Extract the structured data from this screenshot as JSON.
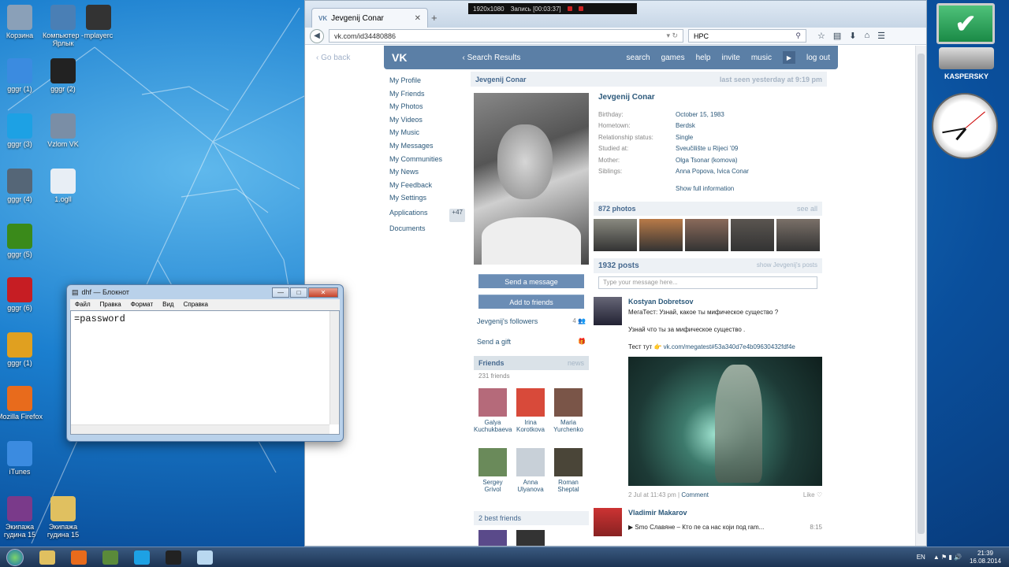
{
  "recorder": {
    "resolution": "1920x1080",
    "status": "Запись [00:03:37]"
  },
  "desktop_icons": [
    {
      "label": "Корзина",
      "icon": "recycle-bin-icon",
      "color": "#8aa0b8"
    },
    {
      "label": "Компьютер - Ярлык",
      "icon": "computer-icon",
      "color": "#4a7fb5"
    },
    {
      "label": "mplayerc",
      "icon": "mplayer-icon",
      "color": "#333333"
    },
    {
      "label": "gggr (1)",
      "icon": "gggr-icon",
      "color": "#3b8be0"
    },
    {
      "label": "gggr (2)",
      "icon": "mpc-be-icon",
      "color": "#222222"
    },
    {
      "label": "gggr (3)",
      "icon": "skype-icon",
      "color": "#1da1e4"
    },
    {
      "label": "Vzlom VK",
      "icon": "settings-icon",
      "color": "#7a8ea6"
    },
    {
      "label": "gggr (4)",
      "icon": "k-lite-icon",
      "color": "#556677"
    },
    {
      "label": "1.ogll",
      "icon": "file-icon",
      "color": "#e8eef5"
    },
    {
      "label": "gggr (5)",
      "icon": "nvidia-icon",
      "color": "#3a8a1a"
    },
    {
      "label": "gggr (6)",
      "icon": "mcafee-icon",
      "color": "#c61d23"
    },
    {
      "label": "gggr (1)",
      "icon": "chrome-icon",
      "color": "#e0a020"
    },
    {
      "label": "Mozilla Firefox",
      "icon": "firefox-icon",
      "color": "#e86b1c"
    },
    {
      "label": "iTunes",
      "icon": "itunes-icon",
      "color": "#3b8be0"
    },
    {
      "label": "Экипажа гудина 15",
      "icon": "archive-icon",
      "color": "#7a3a8a"
    },
    {
      "label": "Экипажа гудина 15",
      "icon": "folder-icon",
      "color": "#e0c060"
    }
  ],
  "browser": {
    "tab_title": "Jevgenij Conar",
    "url": "vk.com/id34480886",
    "search_value": "HPC"
  },
  "vk": {
    "go_back": "Go back",
    "logo": "VK",
    "search_results": "Search Results",
    "menu": [
      "search",
      "games",
      "help",
      "invite",
      "music",
      "log out"
    ],
    "left_menu": [
      "My Profile",
      "My Friends",
      "My Photos",
      "My Videos",
      "My Music",
      "My Messages",
      "My Communities",
      "My News",
      "My Feedback",
      "My Settings"
    ],
    "applications": "Applications",
    "applications_badge": "+47",
    "documents": "Documents",
    "profile_name_header": "Jevgenij Conar",
    "last_seen": "last seen yesterday at 9:19 pm",
    "profile_name": "Jevgenij Conar",
    "info": [
      {
        "label": "Birthday:",
        "value": "October 15, 1983"
      },
      {
        "label": "Hometown:",
        "value": "Berdsk"
      },
      {
        "label": "Relationship status:",
        "value": "Single"
      },
      {
        "label": "Studied at:",
        "value": "Sveučilište u Rijeci '09"
      },
      {
        "label": "Mother:",
        "value": "Olga Tsonar (komova)"
      },
      {
        "label": "Siblings:",
        "value": "Anna Popova, Ivica Conar"
      }
    ],
    "show_full": "Show full information",
    "send_message": "Send a message",
    "add_friend": "Add to friends",
    "followers": "Jevgenij's followers",
    "followers_count": "4",
    "send_gift": "Send a gift",
    "friends_title": "Friends",
    "friends_news": "news",
    "friends_count": "231 friends",
    "friends": [
      {
        "first": "Galya",
        "last": "Kuchukbaeva",
        "color": "#b56a7a"
      },
      {
        "first": "Irina",
        "last": "Korotkova",
        "color": "#d84a3a"
      },
      {
        "first": "Maria",
        "last": "Yurchenko",
        "color": "#7a5548"
      },
      {
        "first": "Sergey",
        "last": "Grivol",
        "color": "#6a8a5a"
      },
      {
        "first": "Anna",
        "last": "Ulyanova",
        "color": "#c8d0d8"
      },
      {
        "first": "Roman",
        "last": "Sheptal",
        "color": "#4a4538"
      }
    ],
    "best_friends": "2 best friends",
    "photos_title": "872 photos",
    "see_all": "see all",
    "photo_colors": [
      "#8a8a80",
      "#b87a48",
      "#8a6a5a",
      "#5a5550",
      "#7a7068"
    ],
    "posts_title": "1932 posts",
    "show_posts": "show Jevgenij's posts",
    "message_placeholder": "Type your message here...",
    "post": {
      "author": "Kostyan Dobretsov",
      "line1": "МегаТест: Узнай, какое ты мифическое существо ?",
      "line2": "Узнай что ты за мифическое существо .",
      "line3_prefix": "Тест тут",
      "link": "vk.com/megatest#53a340d7e4b09630432fdf4e",
      "date": "2 Jul at 11:43 pm",
      "comment": "Comment",
      "like": "Like"
    },
    "post2": {
      "author": "Vladimir Makarov",
      "audio": "Smo Славяне – Кто пе са нас који под ram...",
      "duration": "8:15"
    }
  },
  "notepad": {
    "title": "dhf — Блокнот",
    "menu": [
      "Файл",
      "Правка",
      "Формат",
      "Вид",
      "Справка"
    ],
    "content": "=password"
  },
  "gadgets": {
    "kaspersky": "KASPERSKY"
  },
  "tray": {
    "lang": "EN",
    "time": "21:39",
    "date": "16.08.2014"
  },
  "taskbar_apps": [
    {
      "icon": "explorer-icon",
      "color": "#e0c060"
    },
    {
      "icon": "firefox-icon",
      "color": "#e86b1c"
    },
    {
      "icon": "minecraft-icon",
      "color": "#5a8a3a"
    },
    {
      "icon": "skype-icon",
      "color": "#1da1e4"
    },
    {
      "icon": "mpc-be-icon",
      "color": "#222222"
    },
    {
      "icon": "notepad-icon",
      "color": "#b9d8f0"
    }
  ]
}
